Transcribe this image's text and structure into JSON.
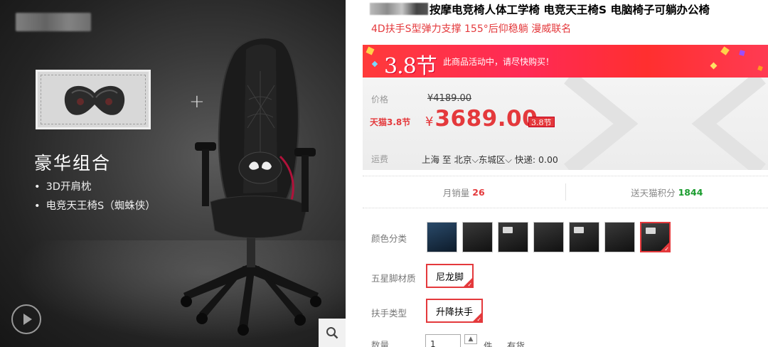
{
  "gallery": {
    "combo_title": "豪华组合",
    "combo_items": [
      "3D开肩枕",
      "电竞天王椅S（蜘蛛侠）"
    ],
    "plus": "+",
    "play_icon": "play-circle-icon",
    "zoom_icon": "magnifier-icon"
  },
  "product": {
    "title": "按摩电竞椅人体工学椅 电竞天王椅S 电脑椅子可躺办公椅",
    "subtitle": "4D扶手S型弹力支撑 155°后仰稳躺 漫威联名"
  },
  "promo": {
    "banner_logo": "3.8节",
    "banner_text": "此商品活动中，请尽快购买！",
    "price_label": "价格",
    "original_price": "¥4189.00",
    "tmall_label": "天猫3.8节",
    "currency": "¥",
    "current_price": "3689.00",
    "badge": "3.8节"
  },
  "shipping": {
    "label": "运费",
    "text": "上海 至 北京⌵东城区⌵ 快递: 0.00"
  },
  "stats": {
    "monthly_sales_label": "月销量",
    "monthly_sales": "26",
    "points_label": "送天猫积分",
    "points": "1844"
  },
  "options": {
    "color_label": "颜色分类",
    "swatch_count_note": "",
    "base_label": "五星脚材质",
    "base_value": "尼龙脚",
    "armrest_label": "扶手类型",
    "armrest_value": "升降扶手",
    "qty_label": "数量",
    "qty_value": "1",
    "qty_unit": "件",
    "stock": "有货"
  },
  "colors": {
    "accent": "#e4393c",
    "points_green": "#1a9c2e"
  }
}
